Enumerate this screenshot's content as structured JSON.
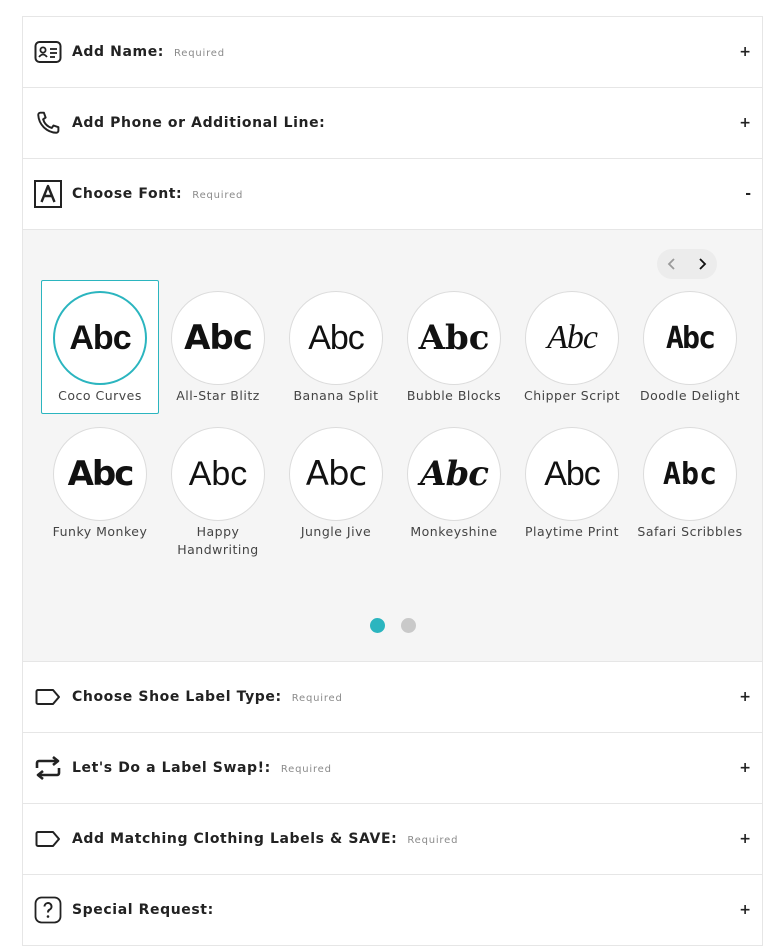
{
  "sections": {
    "name": {
      "title": "Add Name:",
      "required": "Required",
      "toggle": "+"
    },
    "phone": {
      "title": "Add Phone or Additional Line:",
      "toggle": "+"
    },
    "font": {
      "title": "Choose Font:",
      "required": "Required",
      "toggle": "-"
    },
    "shoe": {
      "title": "Choose Shoe Label Type:",
      "required": "Required",
      "toggle": "+"
    },
    "swap": {
      "title": "Let's Do a Label Swap!:",
      "required": "Required",
      "toggle": "+"
    },
    "clothing": {
      "title": "Add Matching Clothing Labels & SAVE:",
      "required": "Required",
      "toggle": "+"
    },
    "special": {
      "title": "Special Request:",
      "toggle": "+"
    }
  },
  "font_picker": {
    "sample_text": "Abc",
    "selected": "Coco Curves",
    "fonts": [
      "Coco Curves",
      "All-Star Blitz",
      "Banana Split",
      "Bubble Blocks",
      "Chipper Script",
      "Doodle Delight",
      "Funky Monkey",
      "Happy Handwriting",
      "Jungle Jive",
      "Monkeyshine",
      "Playtime Print",
      "Safari Scribbles"
    ],
    "pages": 2,
    "current_page": 1
  },
  "colors": {
    "accent": "#2bb5bf",
    "dot_inactive": "#c9c9c9",
    "panel_bg": "#f5f5f5"
  },
  "icons": {
    "name": "id-card-icon",
    "phone": "phone-icon",
    "font": "font-letter-icon",
    "shoe": "tag-icon",
    "swap": "swap-arrows-icon",
    "clothing": "tag-icon",
    "special": "question-icon"
  }
}
